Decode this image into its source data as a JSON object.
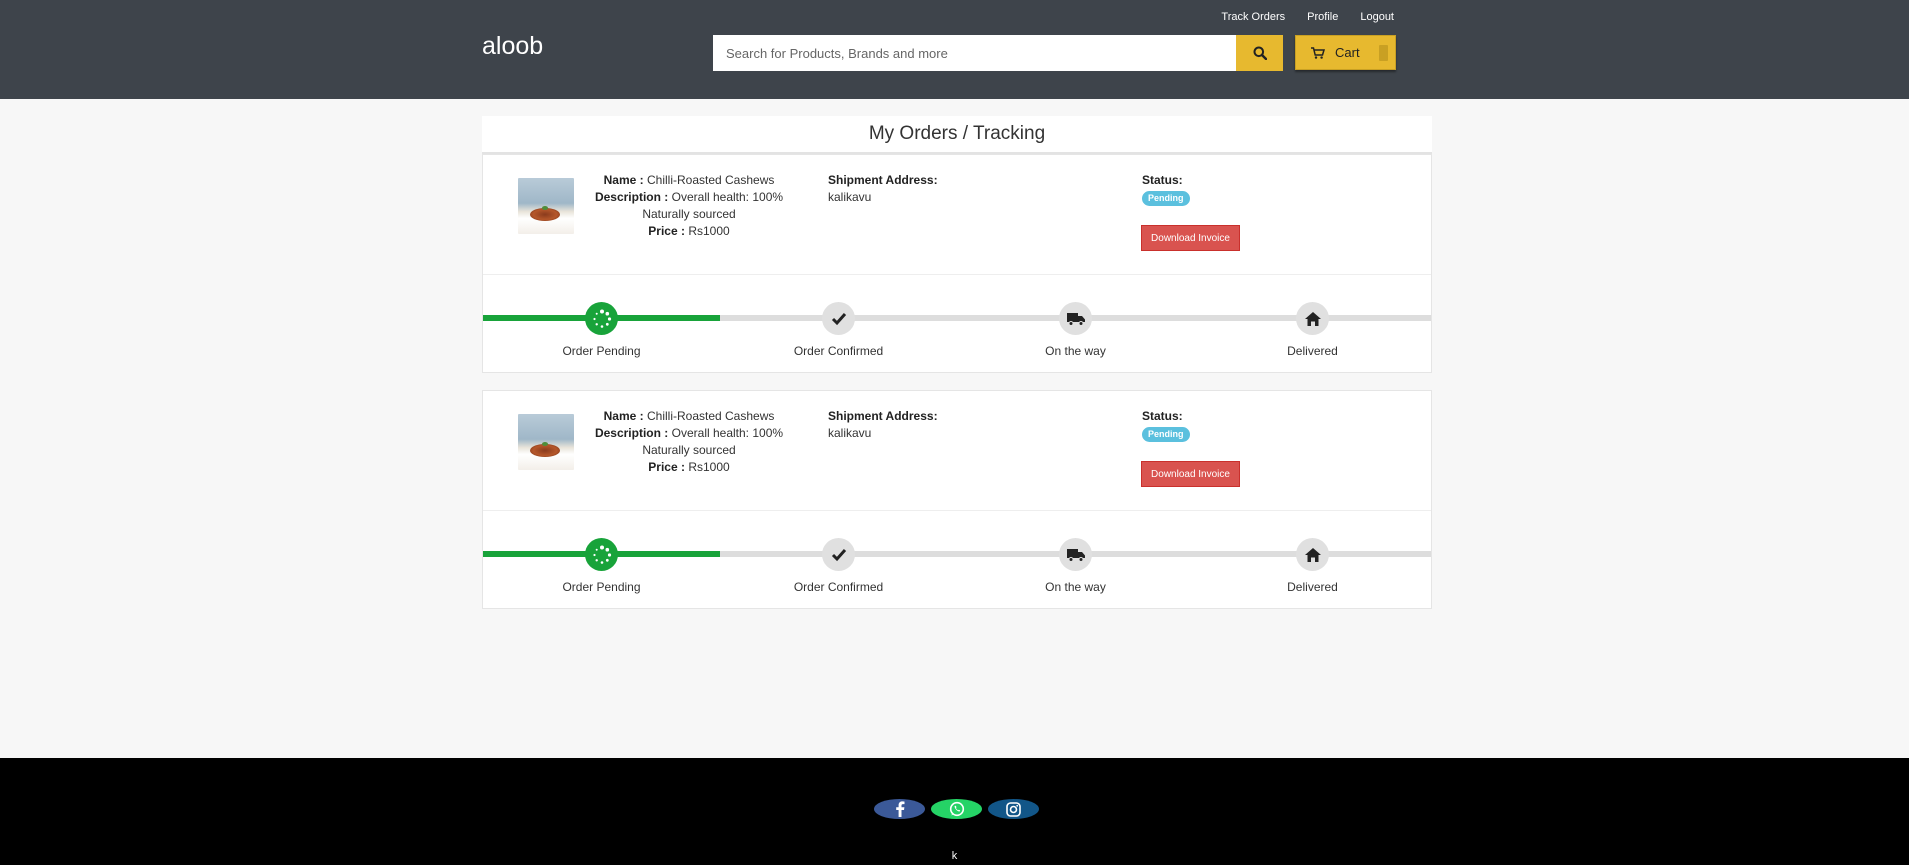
{
  "header": {
    "brand": "aloob",
    "links": {
      "track_orders": "Track Orders",
      "profile": "Profile",
      "logout": "Logout"
    },
    "search": {
      "placeholder": "Search for Products, Brands and more",
      "value": ""
    },
    "cart": {
      "label": "Cart"
    }
  },
  "page_title": "My Orders / Tracking",
  "labels": {
    "name": "Name :",
    "description": "Description :",
    "price": "Price :",
    "shipment": "Shipment Address:",
    "status": "Status:"
  },
  "orders": [
    {
      "name": "Chilli-Roasted Cashews",
      "description": "Overall health: 100% Naturally sourced",
      "price": "Rs1000",
      "address": "kalikavu",
      "status": "Pending",
      "invoice_label": "Download Invoice",
      "progress_fraction": 0.25,
      "steps": [
        "Order Pending",
        "Order Confirmed",
        "On the way",
        "Delivered"
      ]
    },
    {
      "name": "Chilli-Roasted Cashews",
      "description": "Overall health: 100% Naturally sourced",
      "price": "Rs1000",
      "address": "kalikavu",
      "status": "Pending",
      "invoice_label": "Download Invoice",
      "progress_fraction": 0.25,
      "steps": [
        "Order Pending",
        "Order Confirmed",
        "On the way",
        "Delivered"
      ]
    }
  ],
  "footer": {
    "socials": [
      "facebook-icon",
      "whatsapp-icon",
      "instagram-icon"
    ],
    "text": "k"
  },
  "colors": {
    "header_bg": "#3e444b",
    "accent_yellow": "#e7b92f",
    "progress_green": "#18a33a",
    "invoice_red": "#d9534f",
    "badge_blue": "#5bc0de"
  }
}
